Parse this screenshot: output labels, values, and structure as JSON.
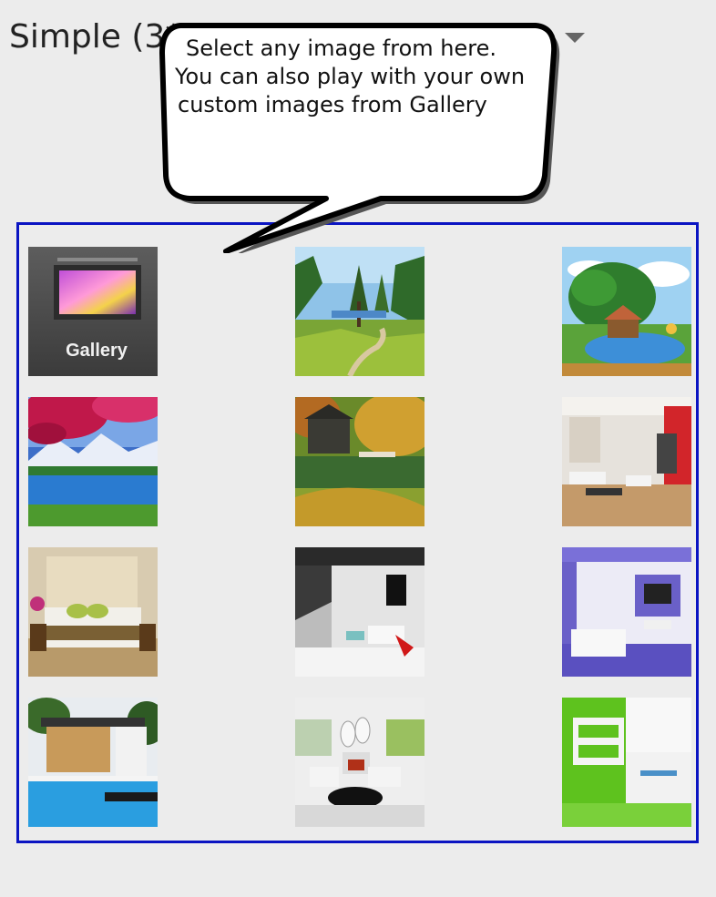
{
  "spinner": {
    "label": "Simple (3*3)",
    "icon": "dropdown-arrow-icon"
  },
  "tooltip": {
    "line1": "Select any image from here.",
    "line2": "You can also play with your own",
    "line3": "custom images from Gallery"
  },
  "gallery_tile": {
    "label": "Gallery",
    "icon": "gallery-icon"
  },
  "colors": {
    "background": "#ececec",
    "grid_border": "#0a14c2"
  }
}
